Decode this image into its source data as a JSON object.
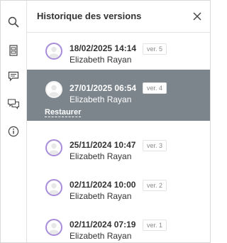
{
  "panel": {
    "title": "Historique des versions",
    "close_icon": "close-icon"
  },
  "rail": [
    {
      "icon": "search-icon"
    },
    {
      "icon": "page-icon"
    },
    {
      "icon": "comment-icon"
    },
    {
      "icon": "comments-icon"
    },
    {
      "icon": "info-icon"
    }
  ],
  "versions": [
    {
      "date": "18/02/2025 14:14",
      "author": "Elizabeth Rayan",
      "version": "ver. 5",
      "active": false
    },
    {
      "date": "27/01/2025 06:54",
      "author": "Elizabeth Rayan",
      "version": "ver. 4",
      "active": true,
      "action": "Restaurer"
    },
    {
      "date": "25/11/2024 10:47",
      "author": "Elizabeth Rayan",
      "version": "ver. 3",
      "active": false
    },
    {
      "date": "02/11/2024 10:00",
      "author": "Elizabeth Rayan",
      "version": "ver. 2",
      "active": false
    },
    {
      "date": "02/11/2024 07:19",
      "author": "Elizabeth Rayan",
      "version": "ver. 1",
      "active": false
    }
  ],
  "colors": {
    "active_row": "#7c858c",
    "avatar_ring": "#a78bdc"
  }
}
